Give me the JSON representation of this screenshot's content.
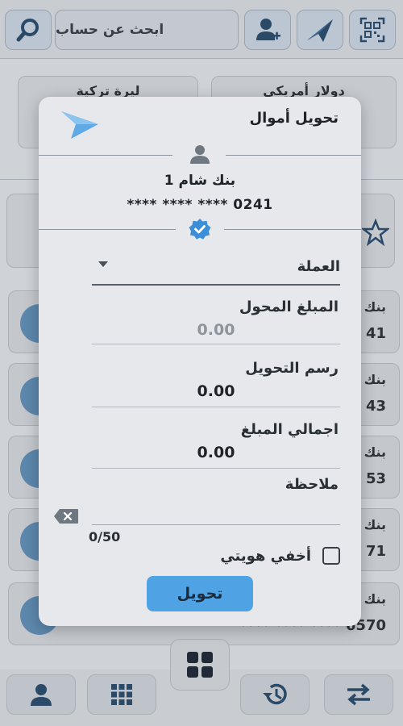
{
  "top_bar": {
    "search_placeholder": "ابحث عن حساب"
  },
  "currency_cards": [
    {
      "label": "دولار أمريكي"
    },
    {
      "label": "ليرة تركية"
    }
  ],
  "accounts_bg": [
    {
      "name": "بنك",
      "number": "41"
    },
    {
      "name": "بنك",
      "number": "43"
    },
    {
      "name": "بنك",
      "number": "53"
    },
    {
      "name": "بنك",
      "number": "71"
    },
    {
      "name": "بنك",
      "number": "**** **** **** 6570"
    }
  ],
  "modal": {
    "title": "تحويل أموال",
    "bank_name": "بنك شام 1",
    "account_masked": "**** **** **** 0241",
    "currency_label": "العملة",
    "fields": [
      {
        "label": "المبلغ المحول",
        "value": "0.00",
        "hint": true
      },
      {
        "label": "رسم التحويل",
        "value": "0.00",
        "hint": false
      },
      {
        "label": "اجمالي المبلغ",
        "value": "0.00",
        "hint": false
      }
    ],
    "note_label": "ملاحظة",
    "note_counter": "0/50",
    "hide_identity_label": "أخفي هويتي",
    "hide_identity_checked": false,
    "submit_label": "تحويل"
  },
  "colors": {
    "accent": "#4fa3e4",
    "verified": "#3b8fd9",
    "modal_bg": "#e6e8ec"
  }
}
